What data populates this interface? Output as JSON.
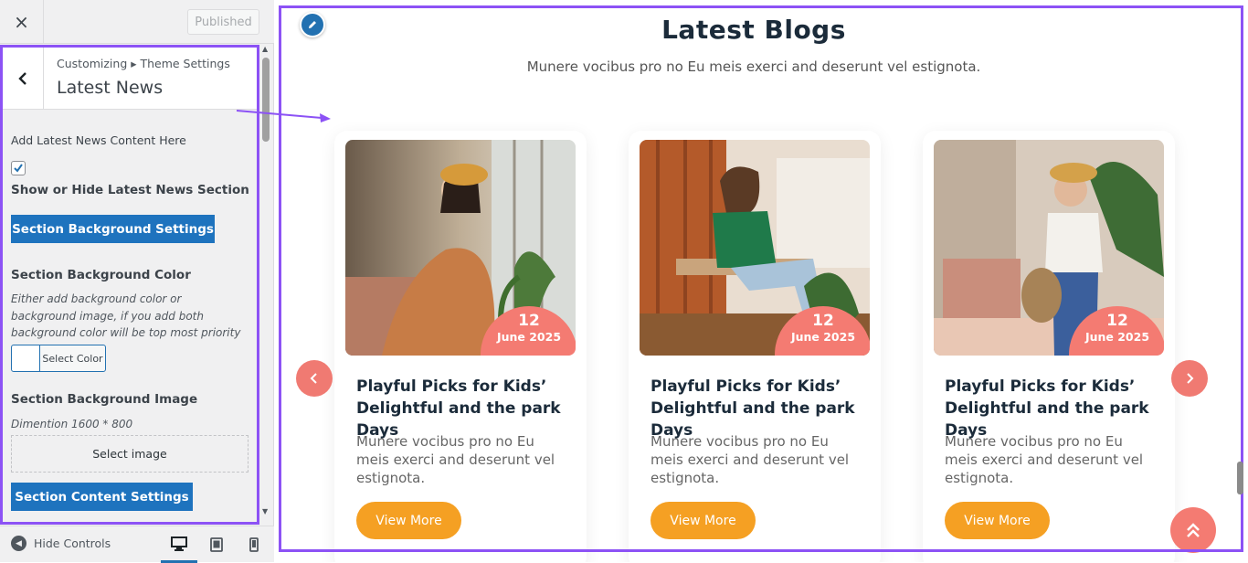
{
  "topbar": {
    "close_icon": "×",
    "publish_label": "Published"
  },
  "panel": {
    "breadcrumb": "Customizing ▸ Theme Settings",
    "title": "Latest News",
    "add_content_label": "Add Latest News Content Here",
    "show_hide_label": "Show or Hide Latest News Section",
    "show_hide_checked": true,
    "bg_settings_button": "Section Background Settings",
    "bg_color_heading": "Section Background Color",
    "bg_color_desc": "Either add background color or background image, if you add both background color will be top most priority",
    "select_color_label": "Select Color",
    "bg_image_heading": "Section Background Image",
    "bg_image_desc": "Dimention 1600 * 800",
    "select_image_label": "Select image",
    "content_settings_button": "Section Content Settings"
  },
  "footer": {
    "hide_controls_label": "Hide Controls",
    "devices": [
      "desktop-icon",
      "tablet-icon",
      "mobile-icon"
    ]
  },
  "preview": {
    "title": "Latest Blogs",
    "subtitle": "Munere vocibus pro no Eu meis exerci and deserunt vel estignota.",
    "cards": [
      {
        "day": "12",
        "month": "June 2025",
        "title": "Playful Picks for Kids’ Delightful and the park Days",
        "excerpt": "Munere vocibus pro no Eu meis exerci and deserunt vel estignota.",
        "button": "View More"
      },
      {
        "day": "12",
        "month": "June 2025",
        "title": "Playful Picks for Kids’ Delightful and the park Days",
        "excerpt": "Munere vocibus pro no Eu meis exerci and deserunt vel estignota.",
        "button": "View More"
      },
      {
        "day": "12",
        "month": "June 2025",
        "title": "Playful Picks for Kids’ Delightful and the park Days",
        "excerpt": "Munere vocibus pro no Eu meis exerci and deserunt vel estignota.",
        "button": "View More"
      }
    ]
  },
  "colors": {
    "accent_purple": "#8c52f5",
    "wp_blue": "#1e73be",
    "badge_coral": "#f47b72",
    "button_orange": "#f5a023",
    "heading_dark": "#1b2b3a"
  }
}
